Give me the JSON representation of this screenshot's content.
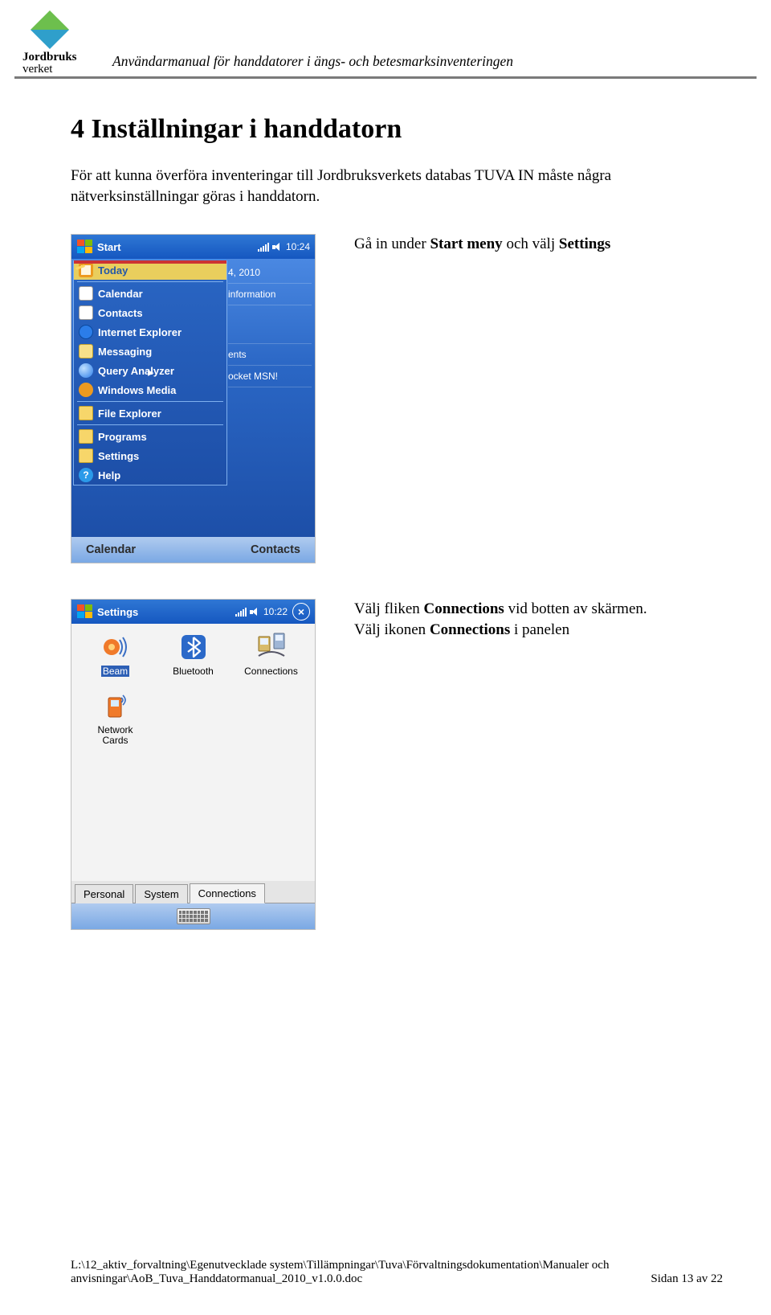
{
  "header": {
    "logo_line1": "Jordbruks",
    "logo_line2": "verket",
    "title": "Användarmanual för handdatorer i ängs- och betesmarksinventeringen"
  },
  "doc": {
    "heading": "4  Inställningar i handdatorn",
    "intro": "För att kunna överföra inventeringar till Jordbruksverkets databas TUVA IN måste några nätverksinställningar göras i handdatorn.",
    "caption1_prefix": "Gå in under ",
    "caption1_b1": "Start meny",
    "caption1_mid": " och välj ",
    "caption1_b2": "Settings",
    "caption2_prefix": "Välj fliken ",
    "caption2_b1": "Connections",
    "caption2_mid": " vid botten av skärmen.",
    "caption2_line2_prefix": "Välj ikonen ",
    "caption2_line2_b": "Connections",
    "caption2_line2_suffix": " i panelen"
  },
  "device1": {
    "app": "Start",
    "time": "10:24",
    "bg_date": "4, 2010",
    "bg_info": "information",
    "bg_appts": "ents",
    "bg_msn": "ocket MSN!",
    "menu": {
      "today": "Today",
      "calendar": "Calendar",
      "contacts": "Contacts",
      "ie": "Internet Explorer",
      "messaging": "Messaging",
      "qa": "Query Analyzer",
      "wm": "Windows Media",
      "fe": "File Explorer",
      "programs": "Programs",
      "settings": "Settings",
      "help": "Help"
    },
    "soft_left": "Calendar",
    "soft_right": "Contacts"
  },
  "device2": {
    "app": "Settings",
    "time": "10:22",
    "close": "×",
    "icons": {
      "beam": "Beam",
      "bluetooth": "Bluetooth",
      "connections": "Connections",
      "network_cards": "Network Cards"
    },
    "tabs": {
      "personal": "Personal",
      "system": "System",
      "connections": "Connections"
    }
  },
  "footer": {
    "left_line1": "L:\\12_aktiv_forvaltning\\Egenutvecklade system\\Tillämpningar\\Tuva\\Förvaltningsdokumentation\\Manualer och",
    "left_line2": "anvisningar\\AoB_Tuva_Handdatormanual_2010_v1.0.0.doc",
    "right": "Sidan 13 av 22"
  }
}
